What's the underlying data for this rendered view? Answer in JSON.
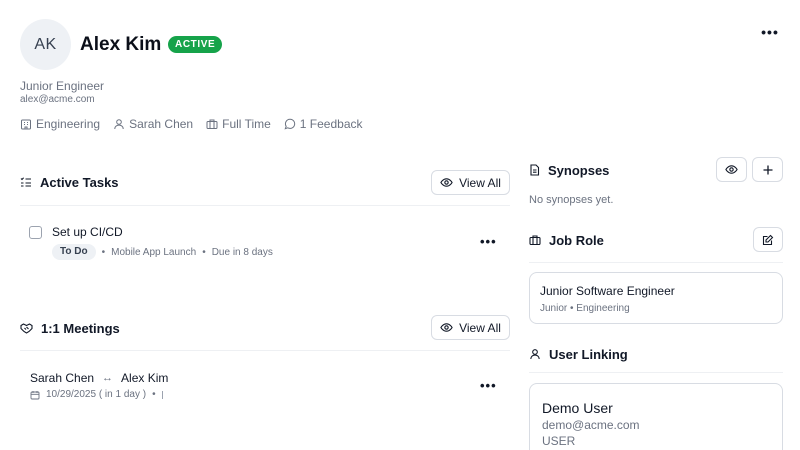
{
  "profile": {
    "initials": "AK",
    "name": "Alex Kim",
    "status": "ACTIVE",
    "title": "Junior Engineer",
    "email": "alex@acme.com",
    "meta": {
      "department": "Engineering",
      "manager": "Sarah Chen",
      "employment": "Full Time",
      "feedback": "1 Feedback"
    },
    "more_icon": "ellipsis-icon"
  },
  "tasks": {
    "title": "Active Tasks",
    "view_all": "View All",
    "items": [
      {
        "title": "Set up CI/CD",
        "status": "To Do",
        "project": "Mobile App Launch",
        "due": "Due in 8 days"
      }
    ]
  },
  "meetings": {
    "title": "1:1 Meetings",
    "view_all": "View All",
    "items": [
      {
        "from": "Sarah Chen",
        "to": "Alex Kim",
        "date": "10/29/2025 ( in 1 day )"
      }
    ]
  },
  "synopses": {
    "title": "Synopses",
    "empty": "No synopses yet."
  },
  "job_role": {
    "title": "Job Role",
    "role_name": "Junior Software Engineer",
    "role_meta": "Junior • Engineering"
  },
  "user_linking": {
    "title": "User Linking",
    "user_name": "Demo User",
    "user_email": "demo@acme.com",
    "user_role": "USER"
  },
  "colors": {
    "active_badge": "#16a34a",
    "muted_text": "#6b7280",
    "border": "#d8dce3"
  }
}
